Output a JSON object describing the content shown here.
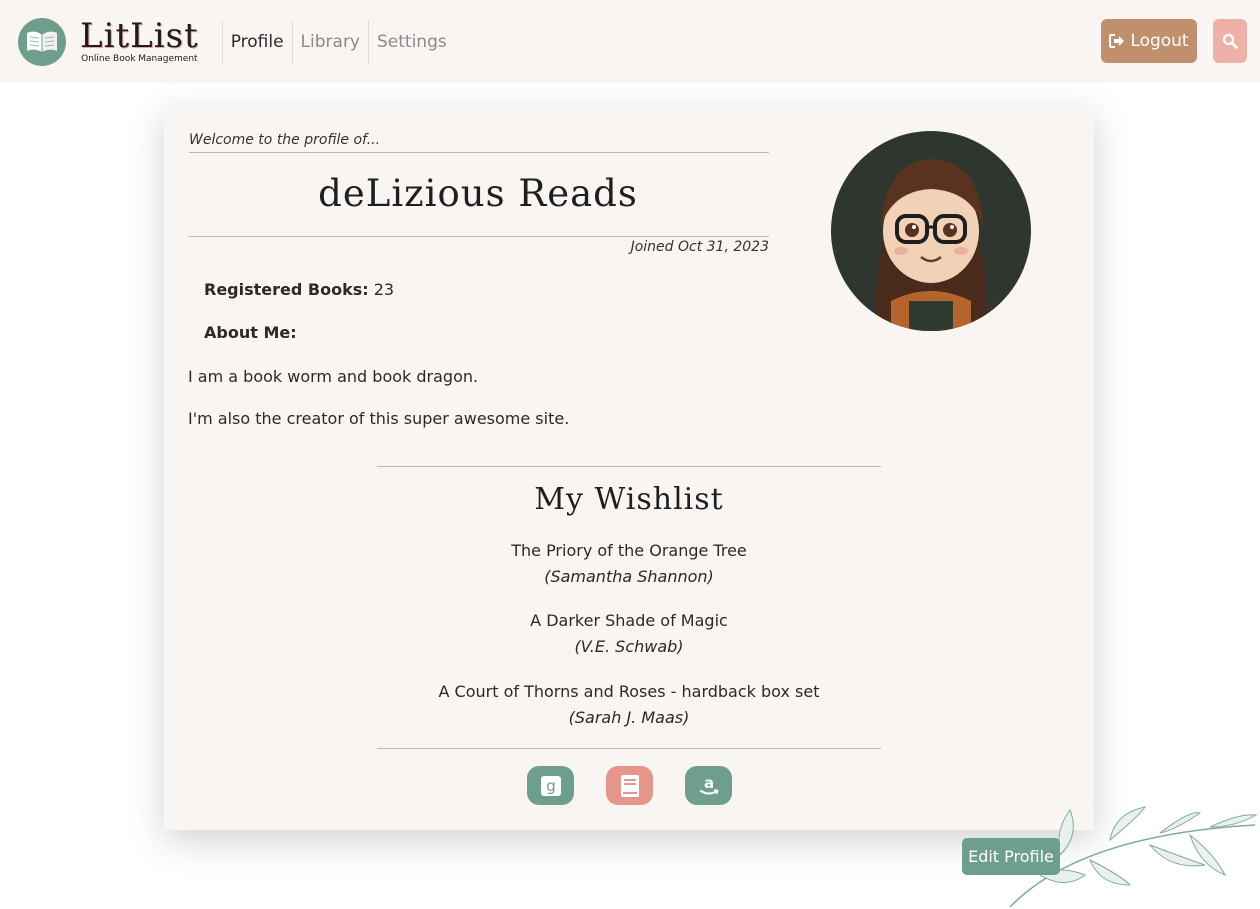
{
  "brand": {
    "title": "LitList",
    "subtitle": "Online Book Management",
    "logo_icon": "open-book-icon",
    "accent_color": "#6e9e8c"
  },
  "nav": {
    "items": [
      {
        "label": "Profile",
        "active": true
      },
      {
        "label": "Library",
        "active": false
      },
      {
        "label": "Settings",
        "active": false
      }
    ]
  },
  "header_actions": {
    "logout_label": "Logout",
    "logout_icon": "sign-out-icon",
    "logout_color": "#c0906e",
    "search_icon": "search-icon",
    "search_color": "#eeb1a8"
  },
  "profile": {
    "welcome": "Welcome to the profile of...",
    "name": "deLizious Reads",
    "joined": "Joined Oct 31, 2023",
    "registered_label": "Registered Books:",
    "registered_value": "23",
    "about_label": "About Me:",
    "about_lines": [
      "I am a book worm and book dragon.",
      "I'm also the creator of this super awesome site."
    ]
  },
  "wishlist": {
    "title": "My Wishlist",
    "items": [
      {
        "title": "The Priory of the Orange Tree",
        "author": "(Samantha Shannon)"
      },
      {
        "title": "A Darker Shade of Magic",
        "author": "(V.E. Schwab)"
      },
      {
        "title": "A Court of Thorns and Roses - hardback box set",
        "author": "(Sarah J. Maas)"
      }
    ]
  },
  "social_links": [
    {
      "icon": "goodreads-icon",
      "color": "#6e9e8c"
    },
    {
      "icon": "book-icon",
      "color": "#e6958b"
    },
    {
      "icon": "amazon-icon",
      "color": "#6e9e8c"
    }
  ],
  "edit_profile_label": "Edit Profile"
}
